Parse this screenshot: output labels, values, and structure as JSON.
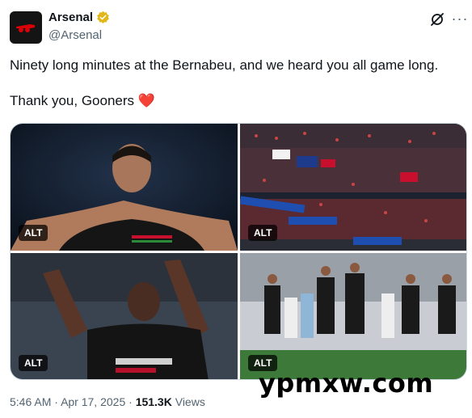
{
  "author": {
    "display_name": "Arsenal",
    "handle": "@Arsenal",
    "avatar_icon": "arsenal-cannon-logo",
    "verified_icon": "verified-gold-badge"
  },
  "header_icons": [
    "grok-icon",
    "more-icon"
  ],
  "tweet": {
    "line1": "Ninety long minutes at the Bernabeu, and we heard you all game long.",
    "line2": "Thank you, Gooners",
    "emoji": "❤️"
  },
  "media": [
    {
      "alt_label": "ALT"
    },
    {
      "alt_label": "ALT"
    },
    {
      "alt_label": "ALT"
    },
    {
      "alt_label": "ALT"
    }
  ],
  "meta": {
    "time": "5:46 AM",
    "separator": "·",
    "date": "Apr 17, 2025",
    "views_count": "151.3K",
    "views_label": "Views"
  },
  "watermark": "ypmxw.com",
  "colors": {
    "text": "#0f1419",
    "secondary": "#536471",
    "heart": "#e0245e",
    "verified": "#e2b719"
  }
}
